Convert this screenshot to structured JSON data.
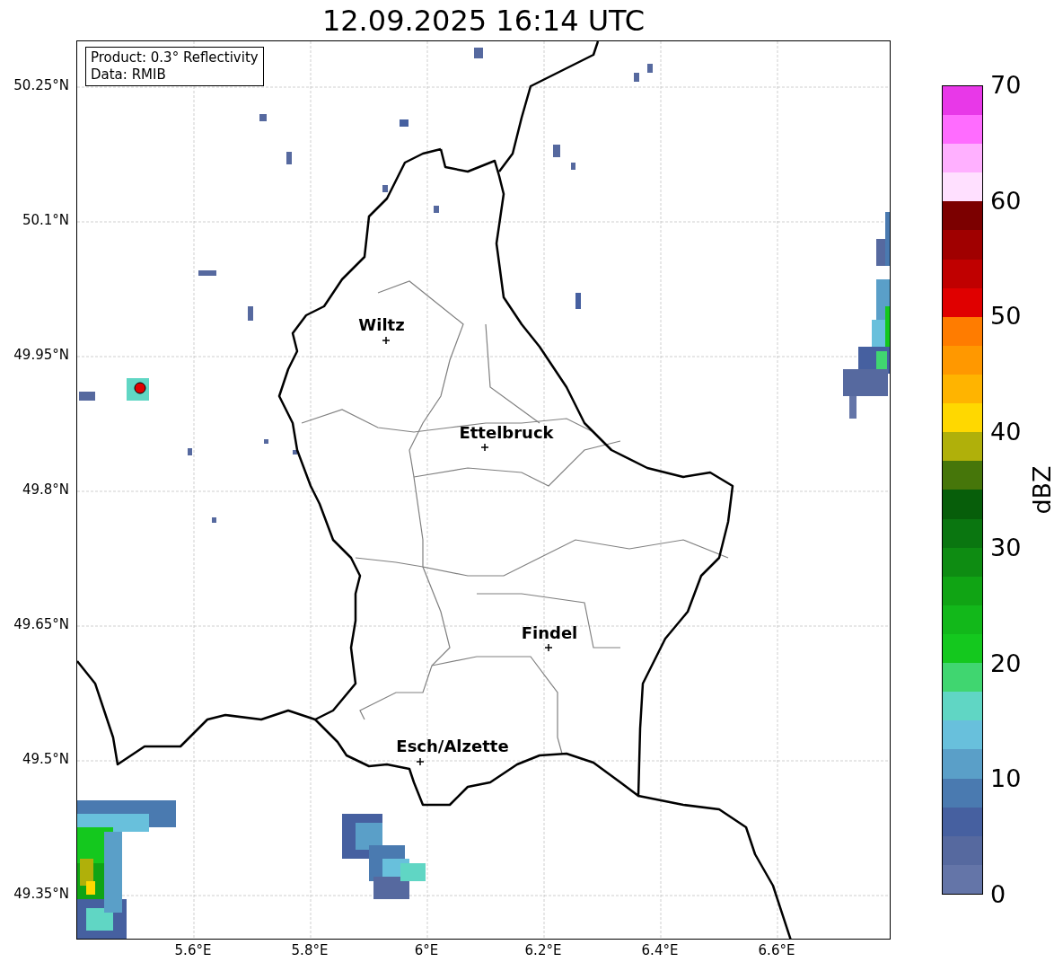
{
  "title": "12.09.2025 16:14 UTC",
  "info_box": {
    "lines": [
      "Product: 0.3° Reflectivity",
      "Data: RMIB"
    ]
  },
  "map": {
    "lat_ticks": [
      "50.25°N",
      "50.1°N",
      "49.95°N",
      "49.8°N",
      "49.65°N",
      "49.5°N",
      "49.35°N"
    ],
    "lon_ticks": [
      "5.6°E",
      "5.8°E",
      "6°E",
      "6.2°E",
      "6.4°E",
      "6.6°E"
    ],
    "places": [
      {
        "name": "Wiltz"
      },
      {
        "name": "Ettelbruck"
      },
      {
        "name": "Findel"
      },
      {
        "name": "Esch/Alzette"
      }
    ]
  },
  "colorbar": {
    "label": "dBZ",
    "ticks": [
      "70",
      "60",
      "50",
      "40",
      "30",
      "20",
      "10",
      "0"
    ],
    "segments": [
      {
        "color": "#6475a8"
      },
      {
        "color": "#56699f"
      },
      {
        "color": "#4660a0"
      },
      {
        "color": "#4a7ab0"
      },
      {
        "color": "#5a9fc8"
      },
      {
        "color": "#68c0dc"
      },
      {
        "color": "#60d6c4"
      },
      {
        "color": "#40d670"
      },
      {
        "color": "#14c81e"
      },
      {
        "color": "#12b81a"
      },
      {
        "color": "#10a414"
      },
      {
        "color": "#0e8c12"
      },
      {
        "color": "#0a7610"
      },
      {
        "color": "#075e0a"
      },
      {
        "color": "#46760a"
      },
      {
        "color": "#b0b00a"
      },
      {
        "color": "#ffd800"
      },
      {
        "color": "#ffb400"
      },
      {
        "color": "#ff9800"
      },
      {
        "color": "#ff7c00"
      },
      {
        "color": "#e00000"
      },
      {
        "color": "#c00000"
      },
      {
        "color": "#a00000"
      },
      {
        "color": "#7c0000"
      },
      {
        "color": "#ffe0ff"
      },
      {
        "color": "#ffb0ff"
      },
      {
        "color": "#ff6cff"
      },
      {
        "color": "#e838e8"
      }
    ]
  }
}
